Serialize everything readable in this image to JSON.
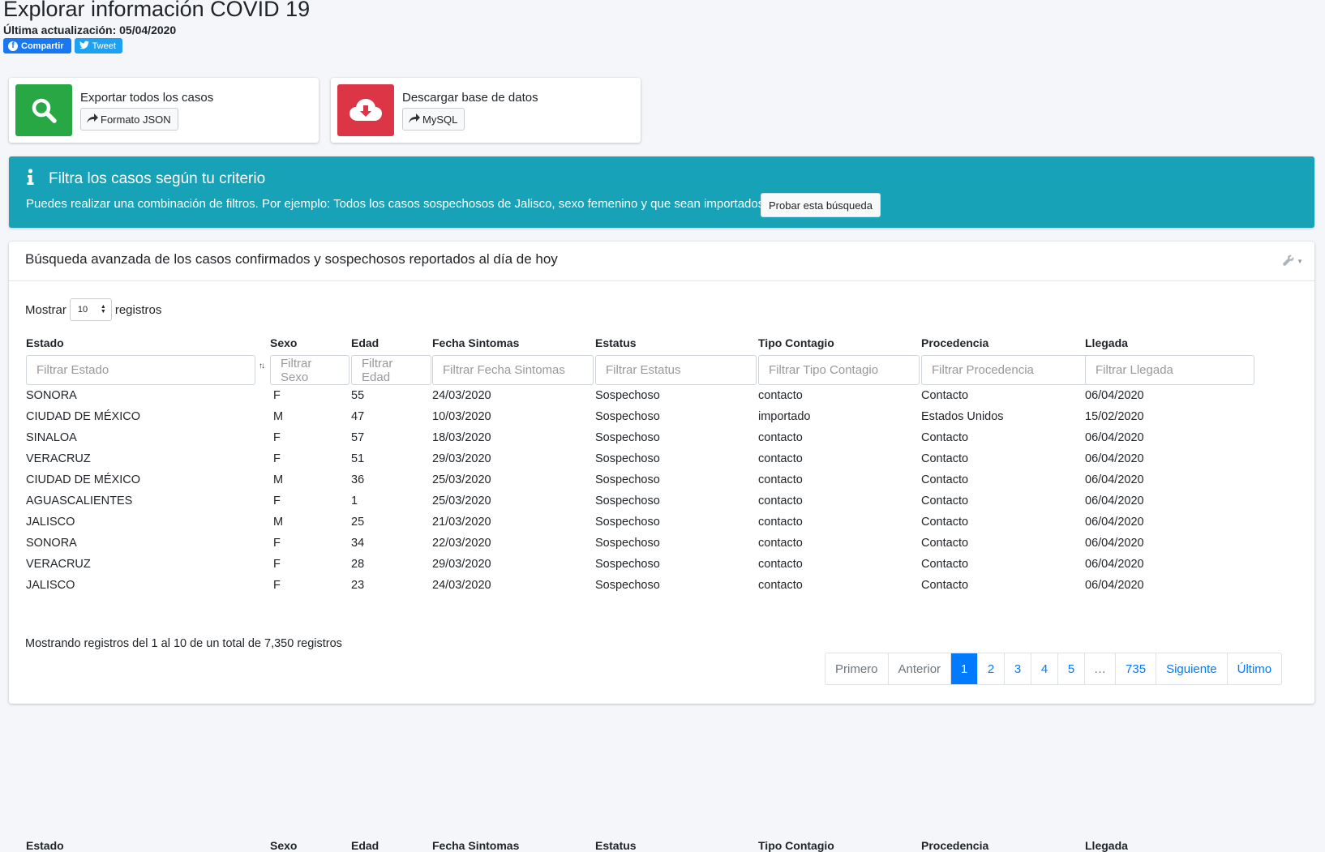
{
  "page": {
    "title": "Explorar información COVID 19",
    "last_update": "Última actualización: 05/04/2020",
    "share_label": "Compartir",
    "tweet_label": "Tweet"
  },
  "info_boxes": [
    {
      "text": "Exportar todos los casos",
      "button": "Formato JSON",
      "icon": "search-icon",
      "color": "#28a745"
    },
    {
      "text": "Descargar base de datos",
      "button": "MySQL",
      "icon": "cloud-download-icon",
      "color": "#dc3545"
    }
  ],
  "callout": {
    "title": "Filtra los casos según tu criterio",
    "body": "Puedes realizar una combinación de filtros. Por ejemplo: Todos los casos sospechosos de Jalisco, sexo femenino y que sean importados.",
    "button": "Probar esta búsqueda",
    "color": "#17a2b8"
  },
  "card": {
    "title": "Búsqueda avanzada de los casos confirmados y sospechosos reportados al día de hoy",
    "length_prefix": "Mostrar",
    "length_value": "10",
    "length_suffix": "registros"
  },
  "table": {
    "headers": [
      "Estado",
      "Sexo",
      "Edad",
      "Fecha Sintomas",
      "Estatus",
      "Tipo Contagio",
      "Procedencia",
      "Llegada"
    ],
    "filters": [
      "Filtrar Estado",
      "Filtrar Sexo",
      "Filtrar Edad",
      "Filtrar Fecha Sintomas",
      "Filtrar Estatus",
      "Filtrar Tipo Contagio",
      "Filtrar Procedencia",
      "Filtrar Llegada"
    ],
    "rows": [
      [
        "SONORA",
        "F",
        "55",
        "24/03/2020",
        "Sospechoso",
        "contacto",
        "Contacto",
        "06/04/2020"
      ],
      [
        "CIUDAD DE MÉXICO",
        "M",
        "47",
        "10/03/2020",
        "Sospechoso",
        "importado",
        "Estados Unidos",
        "15/02/2020"
      ],
      [
        "SINALOA",
        "F",
        "57",
        "18/03/2020",
        "Sospechoso",
        "contacto",
        "Contacto",
        "06/04/2020"
      ],
      [
        "VERACRUZ",
        "F",
        "51",
        "29/03/2020",
        "Sospechoso",
        "contacto",
        "Contacto",
        "06/04/2020"
      ],
      [
        "CIUDAD DE MÉXICO",
        "M",
        "36",
        "25/03/2020",
        "Sospechoso",
        "contacto",
        "Contacto",
        "06/04/2020"
      ],
      [
        "AGUASCALIENTES",
        "F",
        "1",
        "25/03/2020",
        "Sospechoso",
        "contacto",
        "Contacto",
        "06/04/2020"
      ],
      [
        "JALISCO",
        "M",
        "25",
        "21/03/2020",
        "Sospechoso",
        "contacto",
        "Contacto",
        "06/04/2020"
      ],
      [
        "SONORA",
        "F",
        "34",
        "22/03/2020",
        "Sospechoso",
        "contacto",
        "Contacto",
        "06/04/2020"
      ],
      [
        "VERACRUZ",
        "F",
        "28",
        "29/03/2020",
        "Sospechoso",
        "contacto",
        "Contacto",
        "06/04/2020"
      ],
      [
        "JALISCO",
        "F",
        "23",
        "24/03/2020",
        "Sospechoso",
        "contacto",
        "Contacto",
        "06/04/2020"
      ]
    ]
  },
  "footer": {
    "info": "Mostrando registros del 1 al 10 de un total de 7,350 registros"
  },
  "pagination": [
    "Primero",
    "Anterior",
    "1",
    "2",
    "3",
    "4",
    "5",
    "…",
    "735",
    "Siguiente",
    "Último"
  ]
}
